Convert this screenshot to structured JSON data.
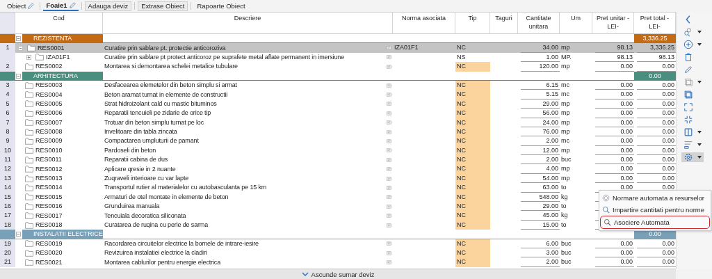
{
  "tabs": [
    {
      "label": "Obiect",
      "kind": "tab",
      "selected": false
    },
    {
      "label": "Foaie1",
      "kind": "tab",
      "selected": true
    },
    {
      "label": "Adauga deviz",
      "kind": "button",
      "selected": false
    },
    {
      "label": "Extrase Obiect",
      "kind": "button",
      "selected": false
    },
    {
      "label": "Rapoarte Obiect",
      "kind": "link",
      "selected": false
    }
  ],
  "table": {
    "columns": [
      "Cod",
      "Descriere",
      "Norma asociata",
      "Tip",
      "Taguri",
      "Cantitate unitara",
      "Um",
      "Pret unitar - LEI-",
      "Pret total - LEI-"
    ],
    "groups": [
      {
        "name": "REZISTENTA",
        "color": "#c46a12",
        "total": "3,336.25",
        "expanded": true,
        "items": [
          {
            "number": "1",
            "code": "RES0001",
            "description": "Curatire prin sablare pt. protectie anticoroziva",
            "norma": "IZA01F1",
            "tip": "NC",
            "flagged": false,
            "quantity": "34.00",
            "um": "mp",
            "unit_price": "98.13",
            "total": "3,336.25",
            "selected": true,
            "expanded": true,
            "children": [
              {
                "code": "IZA01F1",
                "description": "Curatire prin sablare pt protect anticoroz pe suprafete metal aflate permanent in imersiune",
                "tip": "NS",
                "flagged": false,
                "quantity": "1.00",
                "um": "MP.",
                "unit_price": "98.13",
                "total": "98.13",
                "selected": false,
                "expanded": false
              }
            ]
          },
          {
            "number": "2",
            "code": "RES0002",
            "description": "Montarea si demontarea schelei metalice tubulare",
            "tip": "NC",
            "flagged": true,
            "quantity": "120.00",
            "um": "mp",
            "unit_price": "0.00",
            "total": "0.00",
            "selected": false
          }
        ]
      },
      {
        "name": "ARHITECTURA",
        "color": "#4a8e80",
        "total": "0.00",
        "expanded": true,
        "items": [
          {
            "number": "3",
            "code": "RES0003",
            "description": "Desfacearea elemetelor din beton simplu si armat",
            "tip": "NC",
            "flagged": true,
            "quantity": "6.15",
            "um": "mc",
            "unit_price": "0.00",
            "total": "0.00",
            "selected": false
          },
          {
            "number": "4",
            "code": "RES0004",
            "description": "Beton aramat turnat in elemente de constructii",
            "tip": "NC",
            "flagged": true,
            "quantity": "5.15",
            "um": "mc",
            "unit_price": "0.00",
            "total": "0.00",
            "selected": false
          },
          {
            "number": "5",
            "code": "RES0005",
            "description": "Strat hidroizolant cald cu mastic bituminos",
            "tip": "NC",
            "flagged": true,
            "quantity": "29.00",
            "um": "mp",
            "unit_price": "0.00",
            "total": "0.00",
            "selected": false
          },
          {
            "number": "6",
            "code": "RES0006",
            "description": "Reparatii tencuieli pe zidarie de orice tip",
            "tip": "NC",
            "flagged": true,
            "quantity": "56.00",
            "um": "mp",
            "unit_price": "0.00",
            "total": "0.00",
            "selected": false
          },
          {
            "number": "7",
            "code": "RES0007",
            "description": "Trotuar din beton simplu turnat pe loc",
            "tip": "NC",
            "flagged": true,
            "quantity": "24.00",
            "um": "mp",
            "unit_price": "0.00",
            "total": "0.00",
            "selected": false
          },
          {
            "number": "8",
            "code": "RES0008",
            "description": "Invelitoare din tabla zincata",
            "tip": "NC",
            "flagged": true,
            "quantity": "76.00",
            "um": "mp",
            "unit_price": "0.00",
            "total": "0.00",
            "selected": false
          },
          {
            "number": "9",
            "code": "RES0009",
            "description": "Compactarea umpluturii de pamant",
            "tip": "NC",
            "flagged": true,
            "quantity": "2.00",
            "um": "mc",
            "unit_price": "0.00",
            "total": "0.00",
            "selected": false
          },
          {
            "number": "10",
            "code": "RES0010",
            "description": "Pardoseli din beton",
            "tip": "NC",
            "flagged": true,
            "quantity": "12.00",
            "um": "mp",
            "unit_price": "0.00",
            "total": "0.00",
            "selected": false
          },
          {
            "number": "11",
            "code": "RES0011",
            "description": "Reparatii cabina de dus",
            "tip": "NC",
            "flagged": true,
            "quantity": "2.00",
            "um": "buc",
            "unit_price": "0.00",
            "total": "0.00",
            "selected": false
          },
          {
            "number": "12",
            "code": "RES0012",
            "description": "Aplicare qresie in 2 nuante",
            "tip": "NC",
            "flagged": true,
            "quantity": "4.00",
            "um": "mp",
            "unit_price": "0.00",
            "total": "0.00",
            "selected": false
          },
          {
            "number": "13",
            "code": "RES0013",
            "description": "Zuqraveli interioare cu var lapte",
            "tip": "NC",
            "flagged": true,
            "quantity": "54.00",
            "um": "mp",
            "unit_price": "0.00",
            "total": "0.00",
            "selected": false
          },
          {
            "number": "14",
            "code": "RES0014",
            "description": "Transportul rutier al materialelor cu autobasculanta pe 15 km",
            "tip": "NC",
            "flagged": true,
            "quantity": "63.00",
            "um": "to",
            "unit_price": "0.00",
            "total": "0.00",
            "selected": false
          },
          {
            "number": "15",
            "code": "RES0015",
            "description": "Armaturi de otel montate in elemente de beton",
            "tip": "NC",
            "flagged": true,
            "quantity": "548.00",
            "um": "kg",
            "selected": false
          },
          {
            "number": "16",
            "code": "RES0016",
            "description": "Grunduirea manuala",
            "tip": "NC",
            "flagged": true,
            "quantity": "29.00",
            "um": "to",
            "selected": false
          },
          {
            "number": "17",
            "code": "RES0017",
            "description": "Tencuiala decoratica siliconata",
            "tip": "NC",
            "flagged": true,
            "quantity": "45.00",
            "um": "kg",
            "selected": false
          },
          {
            "number": "18",
            "code": "RES0018",
            "description": "Curatarea de ruqina cu perie de sarma",
            "tip": "NC",
            "flagged": true,
            "quantity": "15.00",
            "um": "to",
            "selected": false
          }
        ]
      },
      {
        "name": "INSTALATII ELECTRICE",
        "color": "#7aa0b8",
        "total": "0.00",
        "expanded": true,
        "items": [
          {
            "number": "19",
            "code": "RES0019",
            "description": "Racordarea circuitelor electrice la bornele de intrare-iesire",
            "tip": "NC",
            "flagged": true,
            "quantity": "6.00",
            "um": "buc",
            "unit_price": "0.00",
            "total": "0.00",
            "selected": false
          },
          {
            "number": "20",
            "code": "RES0020",
            "description": "Revizuirea instalatiei electrice la cladiri",
            "tip": "NC",
            "flagged": true,
            "quantity": "3.00",
            "um": "buc",
            "unit_price": "0.00",
            "total": "0.00",
            "selected": false
          },
          {
            "number": "21",
            "code": "RES0021",
            "description": "Montarea cablurilor pentru energie electrica",
            "tip": "NC",
            "flagged": true,
            "quantity": "2.00",
            "um": "buc",
            "unit_price": "0.00",
            "total": "0.00",
            "selected": false
          }
        ]
      }
    ]
  },
  "toolbar": {
    "settings_open": true
  },
  "settings_menu": [
    {
      "label": "Normare automata a resurselor",
      "selected": false
    },
    {
      "label": "Impartire cantitati pentru norme",
      "selected": false
    },
    {
      "label": "Asociere Automata",
      "selected": true
    }
  ],
  "footer": {
    "label": "Ascunde sumar deviz"
  }
}
